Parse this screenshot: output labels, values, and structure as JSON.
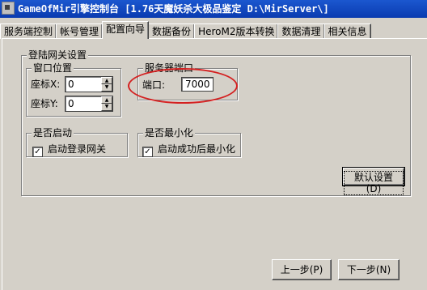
{
  "window": {
    "title": "GameOfMir引擎控制台 [1.76天魔妖杀大极品鉴定 D:\\MirServer\\]"
  },
  "tabs": [
    {
      "label": "服务端控制"
    },
    {
      "label": "帐号管理"
    },
    {
      "label": "配置向导"
    },
    {
      "label": "数据备份"
    },
    {
      "label": "HeroM2版本转换"
    },
    {
      "label": "数据清理"
    },
    {
      "label": "相关信息"
    }
  ],
  "active_tab": "配置向导",
  "login_gateway": {
    "title": "登陆网关设置",
    "window_position": {
      "title": "窗口位置",
      "x_label": "座标X:",
      "x_value": "0",
      "y_label": "座标Y:",
      "y_value": "0"
    },
    "server_port": {
      "title": "服务器端口",
      "port_label": "端口:",
      "port_value": "7000"
    },
    "autostart": {
      "title": "是否启动",
      "checkbox_label": "启动登录网关",
      "checked": true
    },
    "minimize": {
      "title": "是否最小化",
      "checkbox_label": "启动成功后最小化",
      "checked": true
    },
    "default_button": "默认设置(D)"
  },
  "nav": {
    "prev_button": "上一步(P)",
    "next_button": "下一步(N)"
  },
  "annotation_color": "#d42020"
}
